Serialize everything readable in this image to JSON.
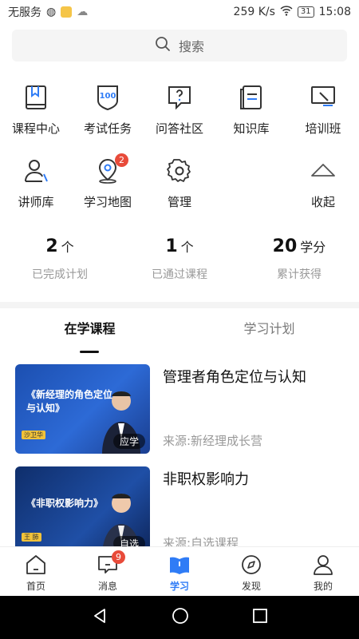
{
  "status_bar": {
    "carrier": "无服务",
    "speed": "259 K/s",
    "battery": "31",
    "time": "15:08"
  },
  "search": {
    "placeholder": "搜索"
  },
  "grid": {
    "row1": [
      {
        "label": "课程中心",
        "icon": "book-bookmark-icon"
      },
      {
        "label": "考试任务",
        "icon": "exam-100-icon"
      },
      {
        "label": "问答社区",
        "icon": "question-chat-icon"
      },
      {
        "label": "知识库",
        "icon": "knowledge-docs-icon"
      },
      {
        "label": "培训班",
        "icon": "training-board-icon"
      }
    ],
    "row2": [
      {
        "label": "讲师库",
        "icon": "lecturer-icon"
      },
      {
        "label": "学习地图",
        "icon": "map-pin-icon",
        "badge": "2"
      },
      {
        "label": "管理",
        "icon": "gear-icon"
      },
      {
        "label": "收起",
        "icon": "chevron-up-icon"
      }
    ]
  },
  "stats": [
    {
      "value": "2",
      "unit": "个",
      "caption": "已完成计划"
    },
    {
      "value": "1",
      "unit": "个",
      "caption": "已通过课程"
    },
    {
      "value": "20",
      "unit": "学分",
      "caption": "累计获得"
    }
  ],
  "tabs": [
    {
      "label": "在学课程",
      "active": true
    },
    {
      "label": "学习计划",
      "active": false
    }
  ],
  "courses": [
    {
      "name": "管理者角色定位与认知",
      "source": "来源:新经理成长营",
      "thumb_title": "《新经理的角色定位与认知》",
      "thumb_speaker": "沙卫华",
      "thumb_tag": "应学"
    },
    {
      "name": "非职权影响力",
      "source": "来源:自选课程",
      "thumb_title": "《非职权影响力》",
      "thumb_speaker": "王 肺",
      "thumb_tag": "自选"
    }
  ],
  "tabbar": [
    {
      "label": "首页",
      "icon": "home-icon"
    },
    {
      "label": "消息",
      "icon": "message-icon",
      "badge": "9"
    },
    {
      "label": "学习",
      "icon": "study-book-icon",
      "active": true
    },
    {
      "label": "发现",
      "icon": "compass-icon"
    },
    {
      "label": "我的",
      "icon": "profile-icon"
    }
  ],
  "colors": {
    "accent": "#2f7cf6",
    "badge": "#e84b3a"
  }
}
